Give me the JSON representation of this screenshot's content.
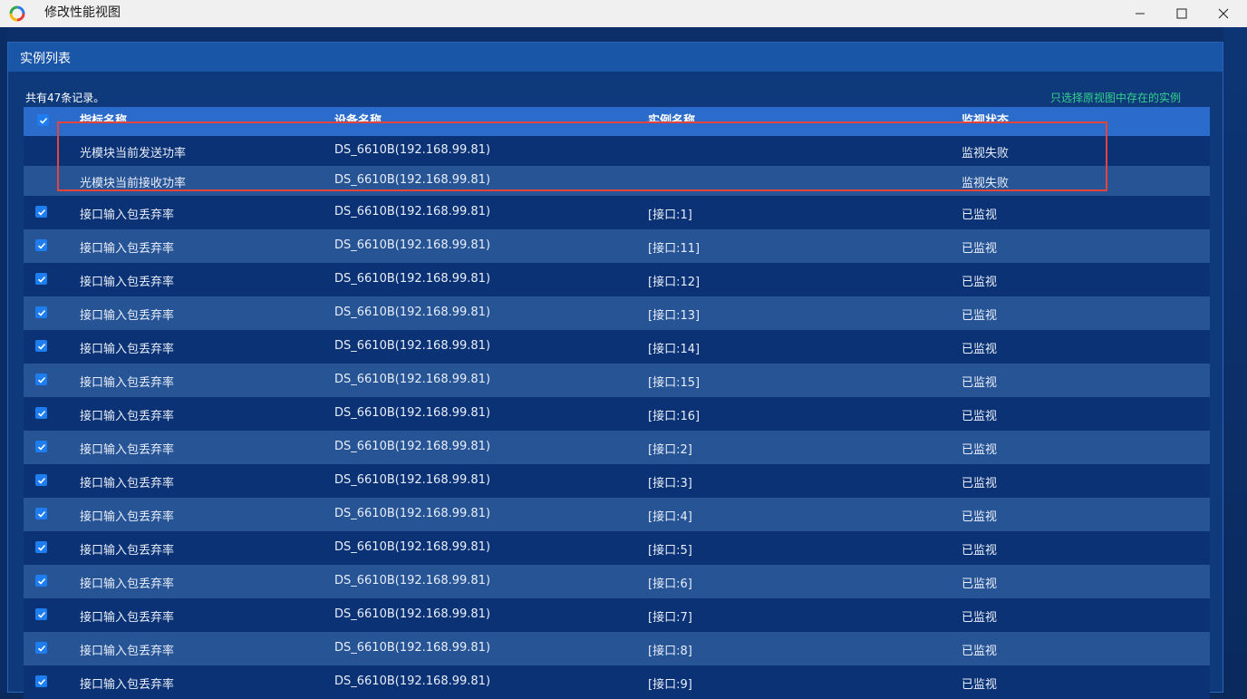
{
  "window": {
    "title": "修改性能视图"
  },
  "panel": {
    "title": "实例列表",
    "record_count": "共有47条记录。",
    "filter_link": "只选择原视图中存在的实例"
  },
  "table": {
    "headers": {
      "name": "指标名称",
      "device": "设备名称",
      "instance": "实例名称",
      "status": "监视状态"
    },
    "rows": [
      {
        "checked": false,
        "name": "光模块当前发送功率",
        "device": "DS_6610B(192.168.99.81)",
        "instance": "",
        "status": "监视失败"
      },
      {
        "checked": false,
        "name": "光模块当前接收功率",
        "device": "DS_6610B(192.168.99.81)",
        "instance": "",
        "status": "监视失败"
      },
      {
        "checked": true,
        "name": "接口输入包丢弃率",
        "device": "DS_6610B(192.168.99.81)",
        "instance": "[接口:1]",
        "status": "已监视"
      },
      {
        "checked": true,
        "name": "接口输入包丢弃率",
        "device": "DS_6610B(192.168.99.81)",
        "instance": "[接口:11]",
        "status": "已监视"
      },
      {
        "checked": true,
        "name": "接口输入包丢弃率",
        "device": "DS_6610B(192.168.99.81)",
        "instance": "[接口:12]",
        "status": "已监视"
      },
      {
        "checked": true,
        "name": "接口输入包丢弃率",
        "device": "DS_6610B(192.168.99.81)",
        "instance": "[接口:13]",
        "status": "已监视"
      },
      {
        "checked": true,
        "name": "接口输入包丢弃率",
        "device": "DS_6610B(192.168.99.81)",
        "instance": "[接口:14]",
        "status": "已监视"
      },
      {
        "checked": true,
        "name": "接口输入包丢弃率",
        "device": "DS_6610B(192.168.99.81)",
        "instance": "[接口:15]",
        "status": "已监视"
      },
      {
        "checked": true,
        "name": "接口输入包丢弃率",
        "device": "DS_6610B(192.168.99.81)",
        "instance": "[接口:16]",
        "status": "已监视"
      },
      {
        "checked": true,
        "name": "接口输入包丢弃率",
        "device": "DS_6610B(192.168.99.81)",
        "instance": "[接口:2]",
        "status": "已监视"
      },
      {
        "checked": true,
        "name": "接口输入包丢弃率",
        "device": "DS_6610B(192.168.99.81)",
        "instance": "[接口:3]",
        "status": "已监视"
      },
      {
        "checked": true,
        "name": "接口输入包丢弃率",
        "device": "DS_6610B(192.168.99.81)",
        "instance": "[接口:4]",
        "status": "已监视"
      },
      {
        "checked": true,
        "name": "接口输入包丢弃率",
        "device": "DS_6610B(192.168.99.81)",
        "instance": "[接口:5]",
        "status": "已监视"
      },
      {
        "checked": true,
        "name": "接口输入包丢弃率",
        "device": "DS_6610B(192.168.99.81)",
        "instance": "[接口:6]",
        "status": "已监视"
      },
      {
        "checked": true,
        "name": "接口输入包丢弃率",
        "device": "DS_6610B(192.168.99.81)",
        "instance": "[接口:7]",
        "status": "已监视"
      },
      {
        "checked": true,
        "name": "接口输入包丢弃率",
        "device": "DS_6610B(192.168.99.81)",
        "instance": "[接口:8]",
        "status": "已监视"
      },
      {
        "checked": true,
        "name": "接口输入包丢弃率",
        "device": "DS_6610B(192.168.99.81)",
        "instance": "[接口:9]",
        "status": "已监视"
      }
    ]
  },
  "colors": {
    "highlight_border": "#e4443b",
    "filter_link": "#33d18a",
    "checkbox_checked": "#1e7ef0"
  }
}
